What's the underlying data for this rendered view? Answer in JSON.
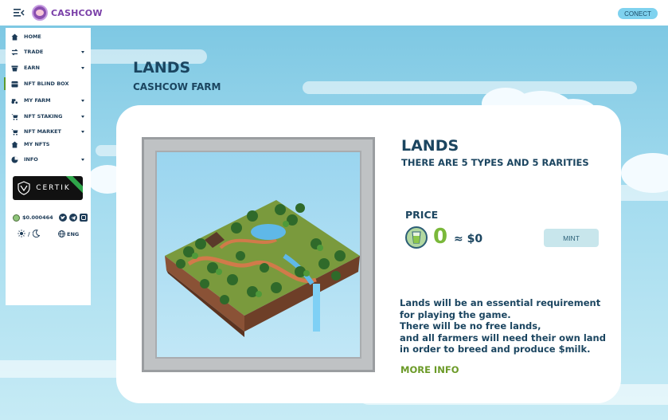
{
  "brand": {
    "name": "CASHCOW"
  },
  "header": {
    "connect_label": "CONECT"
  },
  "sidebar": {
    "items": [
      {
        "label": "HOME",
        "icon": "home-icon",
        "has_submenu": false
      },
      {
        "label": "TRADE",
        "icon": "swap-icon",
        "has_submenu": true
      },
      {
        "label": "EARN",
        "icon": "earn-icon",
        "has_submenu": true
      },
      {
        "label": "NFT BLIND BOX",
        "icon": "box-icon",
        "has_submenu": false,
        "active": true
      },
      {
        "label": "MY FARM",
        "icon": "tractor-icon",
        "has_submenu": true
      },
      {
        "label": "NFT STAKING",
        "icon": "cart-icon",
        "has_submenu": true
      },
      {
        "label": "NFT MARKET",
        "icon": "cart-icon",
        "has_submenu": true
      },
      {
        "label": "MY NFTS",
        "icon": "house-icon",
        "has_submenu": false
      },
      {
        "label": "INFO",
        "icon": "pie-icon",
        "has_submenu": true
      }
    ],
    "audit_badge": "CERTIK",
    "token_price": "$0.000464",
    "theme_toggle": "/",
    "language": "ENG"
  },
  "page": {
    "title": "LANDS",
    "subtitle": "CASHCOW FARM"
  },
  "card": {
    "title": "LANDS",
    "subtitle": "THERE ARE 5 TYPES AND 5 RARITIES",
    "price_label": "PRICE",
    "price_value": "0",
    "price_usd": "≈ $0",
    "mint_label": "MINT",
    "description": [
      "Lands will be an essential requirement",
      "for playing the game.",
      "There will be no free lands,",
      "and all farmers will need their own land",
      "in order to breed and produce $milk."
    ],
    "more_info_label": "MORE INFO"
  },
  "colors": {
    "accent_green": "#7ab83a",
    "navy": "#1b4560",
    "connect_bg": "#7fd2ef",
    "mint_bg": "#c8e6ec"
  }
}
